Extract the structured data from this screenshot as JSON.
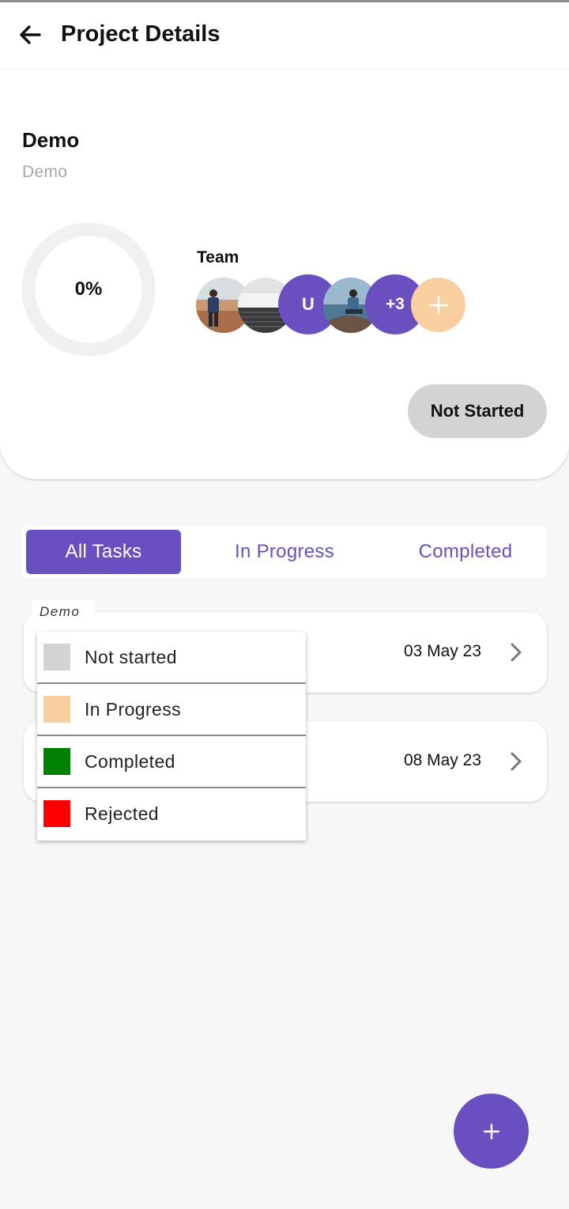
{
  "appbar": {
    "title": "Project Details",
    "back_icon": "arrow-left-icon"
  },
  "project": {
    "name": "Demo",
    "description": "Demo",
    "progress_text": "0%",
    "progress_fraction": 0
  },
  "team": {
    "label": "Team",
    "members": [
      {
        "type": "photo",
        "description": "person standing outdoors"
      },
      {
        "type": "photo",
        "description": "laptop keyboard"
      },
      {
        "type": "initial",
        "text": "U",
        "color": "#6a4fc0"
      },
      {
        "type": "photo",
        "description": "person sitting on rock by water"
      },
      {
        "type": "count",
        "text": "+3",
        "color": "#6a4fc0"
      }
    ],
    "add_icon": "plus-icon",
    "add_color": "#f9cfa0"
  },
  "status": {
    "label": "Not Started",
    "color": "#d3d3d3"
  },
  "tabs": [
    {
      "label": "All Tasks",
      "active": true
    },
    {
      "label": "In Progress",
      "active": false
    },
    {
      "label": "Completed",
      "active": false
    }
  ],
  "group": {
    "label": "Demo"
  },
  "tasks": [
    {
      "date": "03 May 23"
    },
    {
      "date": "08 May 23"
    }
  ],
  "legend": [
    {
      "label": "Not started",
      "color": "#d3d3d3"
    },
    {
      "label": "In Progress",
      "color": "#f9cfa0"
    },
    {
      "label": "Completed",
      "color": "#008000"
    },
    {
      "label": "Rejected",
      "color": "#ff0000"
    }
  ],
  "fab": {
    "icon": "plus-icon"
  },
  "colors": {
    "accent": "#6a4fc0"
  }
}
